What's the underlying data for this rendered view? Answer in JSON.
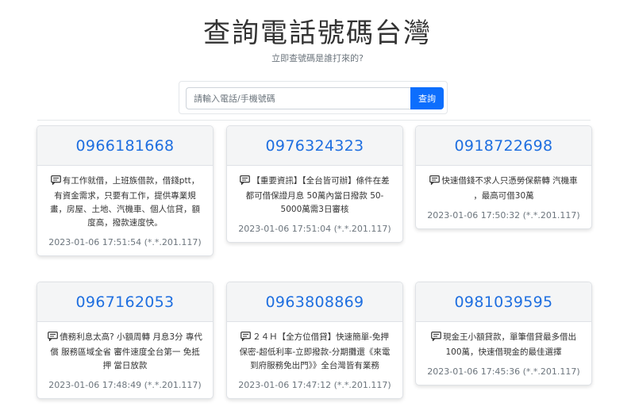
{
  "header": {
    "title": "查詢電話號碼台灣",
    "subtitle": "立即查號碼是誰打來的?"
  },
  "search": {
    "placeholder": "請輸入電話/手機號碼",
    "button_label": "查詢"
  },
  "cards": [
    {
      "phone": "0966181668",
      "message": "有工作就借，上班族借款，借錢ptt，有資金需求，只要有工作，提供專業規畫，房屋、土地、汽機車、個人信貸，額度高，撥款速度快。",
      "meta": "2023-01-06 17:51:54 (*.*.201.117)"
    },
    {
      "phone": "0976324323",
      "message": "【重要資訊】【全台皆可辦】條件在差都可借保證月息 50萬內當日撥款 50-5000萬需3日審核",
      "meta": "2023-01-06 17:51:04 (*.*.201.117)"
    },
    {
      "phone": "0918722698",
      "message": "快速借錢不求人只憑勞保薪轉 汽機車 ，最高可借30萬",
      "meta": "2023-01-06 17:50:32 (*.*.201.117)"
    },
    {
      "phone": "0967162053",
      "message": "債務利息太高? 小額周轉 月息3分 專代償 服務區域全省 審件速度全台第一 免抵押 當日放款",
      "meta": "2023-01-06 17:48:49 (*.*.201.117)"
    },
    {
      "phone": "0963808869",
      "message": "２４Ｈ【全方位借貸】快速簡單-免押保密-超低利率-立即撥款-分期攤還《來電到府服務免出門》》全台灣皆有業務",
      "meta": "2023-01-06 17:47:12 (*.*.201.117)"
    },
    {
      "phone": "0981039595",
      "message": "現金王小額貸款，單筆借貸最多借出100萬，快速借現金的最佳選擇",
      "meta": "2023-01-06 17:45:36 (*.*.201.117)"
    }
  ],
  "icons": {
    "message": "message-icon"
  },
  "colors": {
    "accent": "#0d6efd",
    "phone_link": "#1f6fe0",
    "card_header": "#f4f5f6"
  }
}
